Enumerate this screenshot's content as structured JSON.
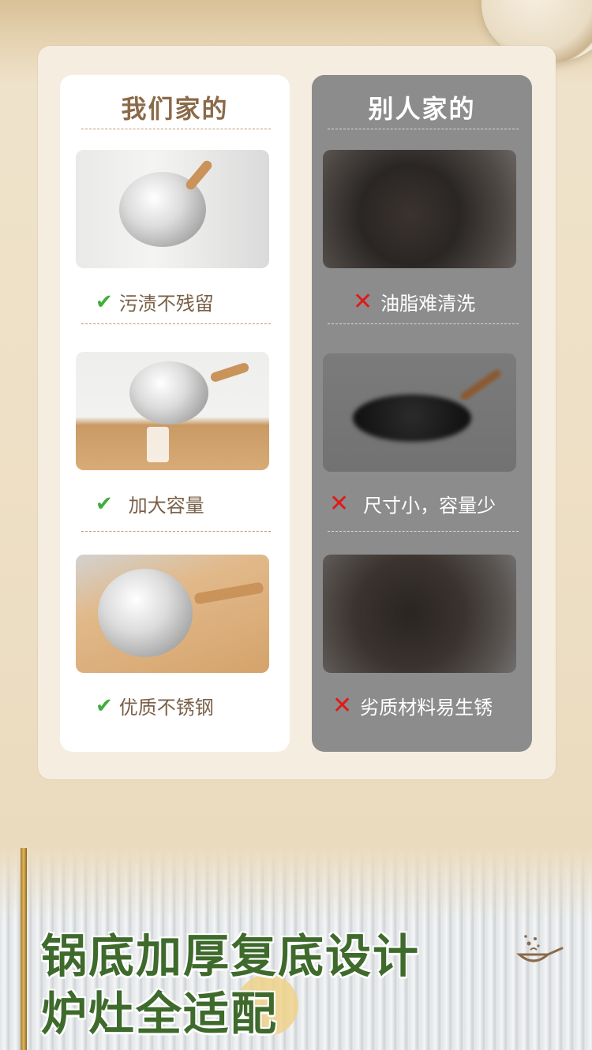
{
  "comparison": {
    "ours": {
      "title": "我们家的",
      "items": [
        "污渍不残留",
        "加大容量",
        "优质不锈钢"
      ]
    },
    "others": {
      "title": "别人家的",
      "items": [
        "油脂难清洗",
        "尺寸小，容量少",
        "劣质材料易生锈"
      ]
    }
  },
  "banner": {
    "line1": "锅底加厚复底设计",
    "line2": "炉灶全适配"
  },
  "icons": {
    "check": "✔",
    "cross": "✕",
    "wok": "wok-cooking-icon"
  },
  "colors": {
    "brown_title": "#8b6a4a",
    "check_green": "#3fae3c",
    "cross_red": "#e01a1a",
    "headline_green": "#3e6a2c",
    "gray_card": "#8c8c8c"
  }
}
